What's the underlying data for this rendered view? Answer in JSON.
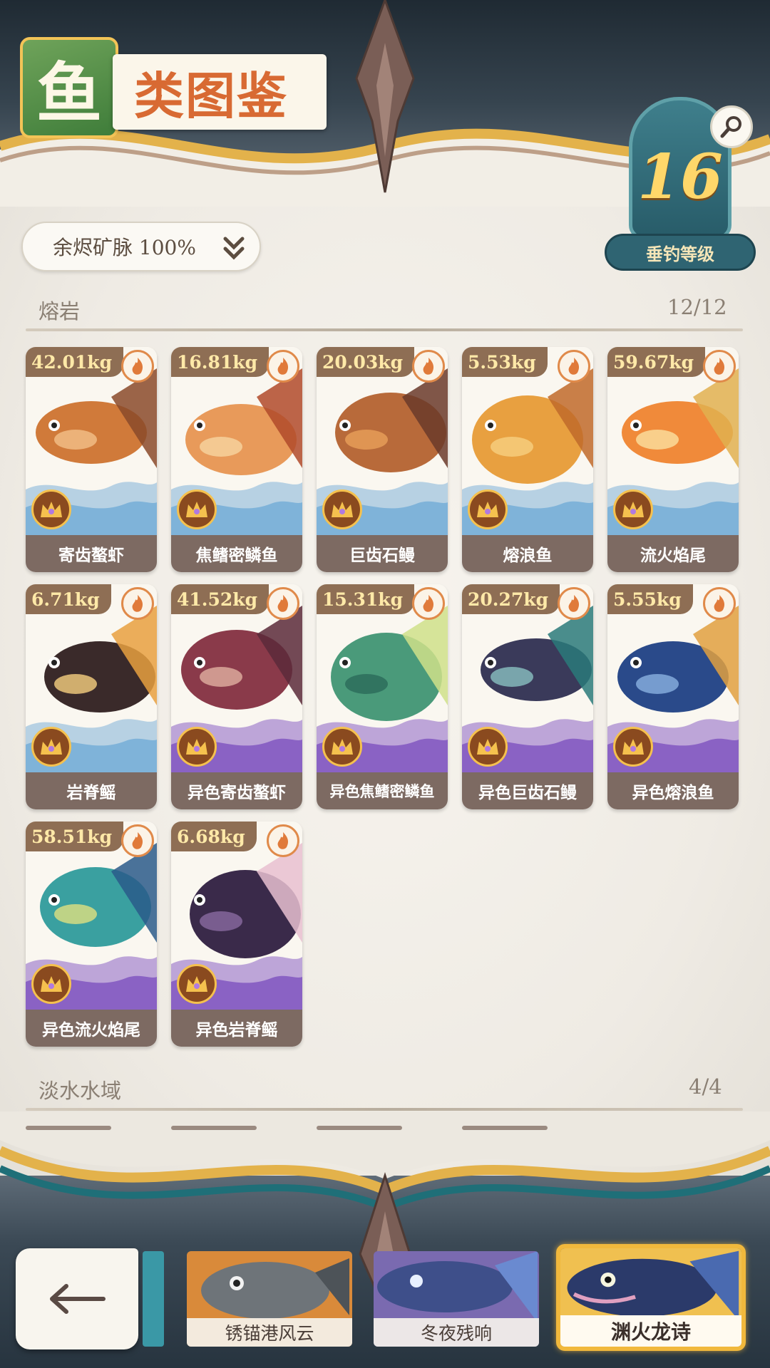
{
  "header": {
    "title_char": "鱼",
    "title_rest": "类图鉴"
  },
  "level": {
    "value": "16",
    "label": "垂钓等级"
  },
  "filter": {
    "label": "余烬矿脉 100%"
  },
  "sections": [
    {
      "title": "熔岩",
      "count": "12/12",
      "fish": [
        {
          "weight": "42.01kg",
          "name": "寄齿螯虾",
          "variant": "normal",
          "palette": [
            "#d07a3a",
            "#8a4a2a",
            "#f2c08a"
          ]
        },
        {
          "weight": "16.81kg",
          "name": "焦鳍密鳞鱼",
          "variant": "normal",
          "palette": [
            "#e89a5a",
            "#b04a2a",
            "#f6d4a0"
          ]
        },
        {
          "weight": "20.03kg",
          "name": "巨齿石鳗",
          "variant": "normal",
          "palette": [
            "#b86a3a",
            "#6a3a2a",
            "#e8a05a"
          ]
        },
        {
          "weight": "5.53kg",
          "name": "熔浪鱼",
          "variant": "normal",
          "palette": [
            "#e8a040",
            "#c06a2a",
            "#f6d080"
          ]
        },
        {
          "weight": "59.67kg",
          "name": "流火焰尾",
          "variant": "normal",
          "palette": [
            "#f08a3a",
            "#e0b050",
            "#fbe0a0"
          ]
        },
        {
          "weight": "6.71kg",
          "name": "岩脊鳐",
          "variant": "normal",
          "palette": [
            "#3a2a2a",
            "#e8a040",
            "#f6d080"
          ]
        },
        {
          "weight": "41.52kg",
          "name": "异色寄齿螯虾",
          "variant": "shiny",
          "palette": [
            "#8a3a4a",
            "#5a2a3a",
            "#e0b0a0"
          ]
        },
        {
          "weight": "15.31kg",
          "name": "异色焦鳍密鳞鱼",
          "variant": "shiny",
          "palette": [
            "#4a9a7a",
            "#cfe08a",
            "#2a6a5a"
          ]
        },
        {
          "weight": "20.27kg",
          "name": "异色巨齿石鳗",
          "variant": "shiny",
          "palette": [
            "#3a3a5a",
            "#2a7a7a",
            "#8ac0c0"
          ]
        },
        {
          "weight": "5.55kg",
          "name": "异色熔浪鱼",
          "variant": "shiny",
          "palette": [
            "#2a4a8a",
            "#e0a040",
            "#8ab0e0"
          ]
        },
        {
          "weight": "58.51kg",
          "name": "异色流火焰尾",
          "variant": "shiny",
          "palette": [
            "#3aa0a0",
            "#2a5a8a",
            "#e0e080"
          ]
        },
        {
          "weight": "6.68kg",
          "name": "异色岩脊鳐",
          "variant": "shiny",
          "palette": [
            "#3a2a4a",
            "#e8c0d0",
            "#8a6aa0"
          ]
        }
      ]
    },
    {
      "title": "淡水水域",
      "count": "4/4",
      "fish": []
    }
  ],
  "bottom_tabs": [
    {
      "label": "锈锚港风云",
      "active": false
    },
    {
      "label": "冬夜残响",
      "active": false
    },
    {
      "label": "渊火龙诗",
      "active": true
    }
  ],
  "colors": {
    "normal_water": "#7fb3d9",
    "shiny_water": "#8a62c4",
    "card_name_bg": "#7d6a62",
    "weight_text": "#ffe9a8",
    "active_tab_border": "#f1b83c"
  }
}
